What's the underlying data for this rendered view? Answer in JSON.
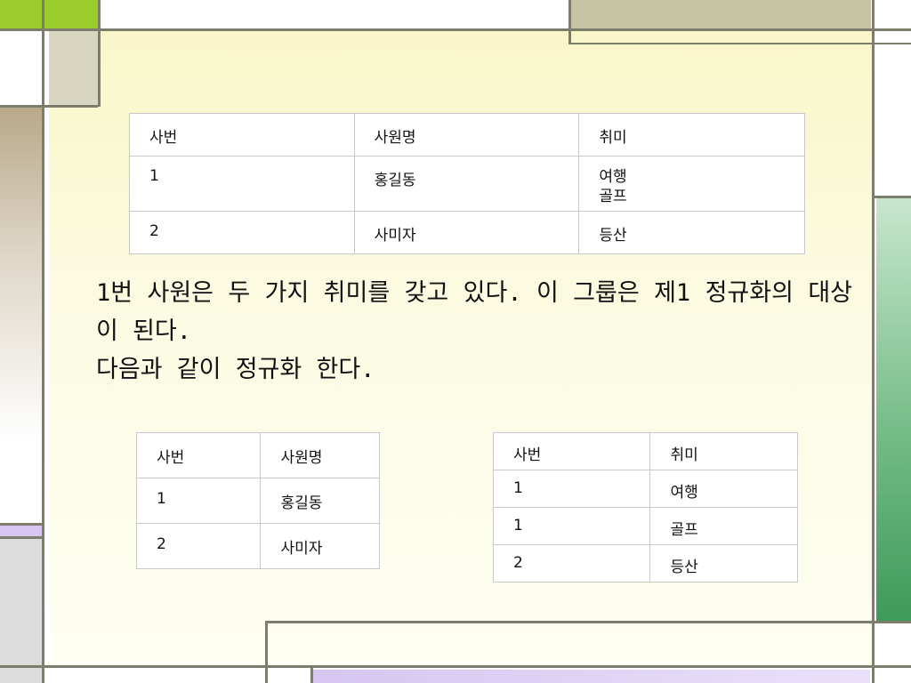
{
  "colors": {
    "accent_green": "#9acd2c",
    "frame_line": "#7d7d6e",
    "olive_block": "#c6c3a4",
    "green_bar": "#3e9a5a",
    "tan_bar": "#b9a88a",
    "lavender_bar": "#d6c6f0"
  },
  "table_main": {
    "headers": [
      "사번",
      "사원명",
      "취미"
    ],
    "rows": [
      [
        "1",
        "홍길동",
        "여행\n골프"
      ],
      [
        "2",
        "사미자",
        "등산"
      ]
    ]
  },
  "body_text": {
    "para1": "1번 사원은 두 가지 취미를 갖고 있다. 이 그룹은 제1 정규화의 대상이 된다.",
    "para2": "다음과 같이 정규화 한다."
  },
  "table_left": {
    "headers": [
      "사번",
      "사원명"
    ],
    "rows": [
      [
        "1",
        "홍길동"
      ],
      [
        "2",
        "사미자"
      ]
    ]
  },
  "table_right": {
    "headers": [
      "사번",
      "취미"
    ],
    "rows": [
      [
        "1",
        "여행"
      ],
      [
        "1",
        "골프"
      ],
      [
        "2",
        "등산"
      ]
    ]
  }
}
